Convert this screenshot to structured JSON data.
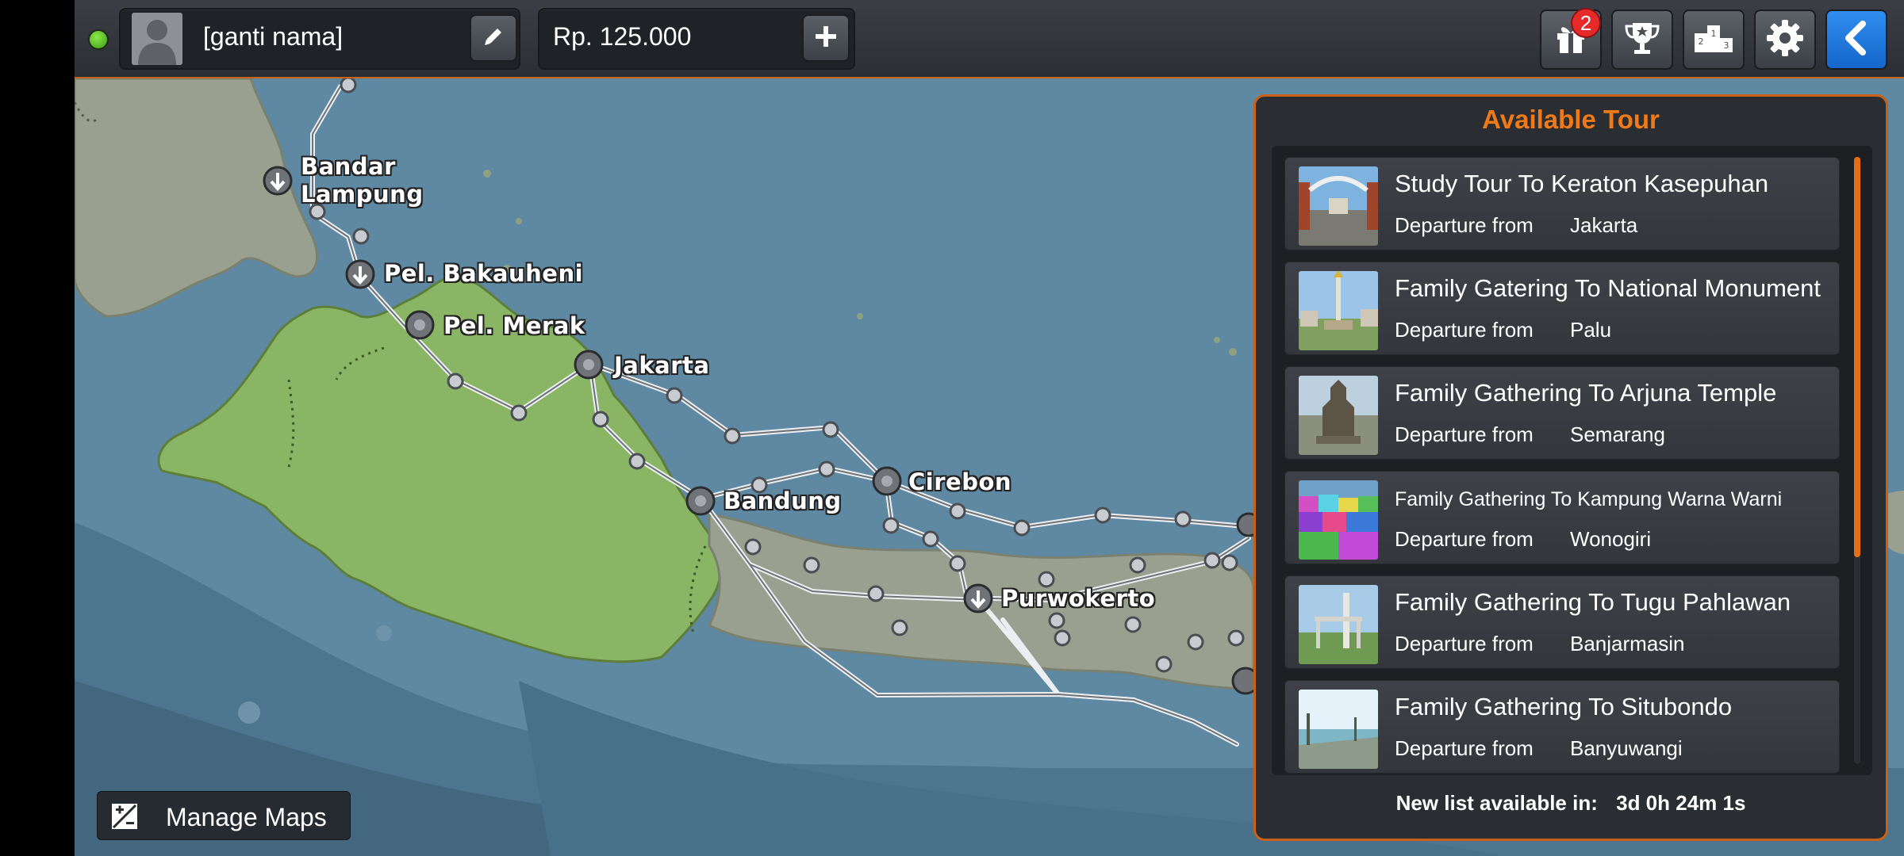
{
  "header": {
    "player_name": "[ganti nama]",
    "money": "Rp. 125.000",
    "gift_badge": "2"
  },
  "icons": {
    "status": "online-dot-icon",
    "avatar": "user-avatar-icon",
    "edit": "pencil-icon",
    "add_money": "plus-icon",
    "gift": "gift-icon",
    "achievements": "trophy-icon",
    "leaderboard": "podium-icon",
    "settings": "gear-icon",
    "back": "chevron-left-icon",
    "manage_maps": "map-edit-icon"
  },
  "colors": {
    "accent": "#f07a17",
    "back_button": "#1f78e0",
    "badge": "#e62a2a",
    "status_online": "#5bc428"
  },
  "map": {
    "cities": [
      {
        "name": "Bandar\nLampung"
      },
      {
        "name": "Pel. Bakauheni"
      },
      {
        "name": "Pel. Merak"
      },
      {
        "name": "Jakarta"
      },
      {
        "name": "Bandung"
      },
      {
        "name": "Cirebon"
      },
      {
        "name": "Purwokerto"
      }
    ]
  },
  "tour_panel": {
    "title": "Available Tour",
    "departure_label": "Departure from",
    "tours": [
      {
        "name": "Study Tour To Keraton Kasepuhan",
        "departure": "Jakarta"
      },
      {
        "name": "Family Gatering To National Monument",
        "departure": "Palu"
      },
      {
        "name": "Family Gathering To Arjuna Temple",
        "departure": "Semarang"
      },
      {
        "name": "Family Gathering To Kampung Warna Warni",
        "departure": "Wonogiri"
      },
      {
        "name": "Family Gathering To Tugu Pahlawan",
        "departure": "Banjarmasin"
      },
      {
        "name": "Family Gathering To Situbondo",
        "departure": "Banyuwangi"
      }
    ],
    "new_list_label": "New list available in:",
    "new_list_time": "3d 0h 24m 1s"
  },
  "manage_maps": {
    "label": "Manage Maps"
  }
}
